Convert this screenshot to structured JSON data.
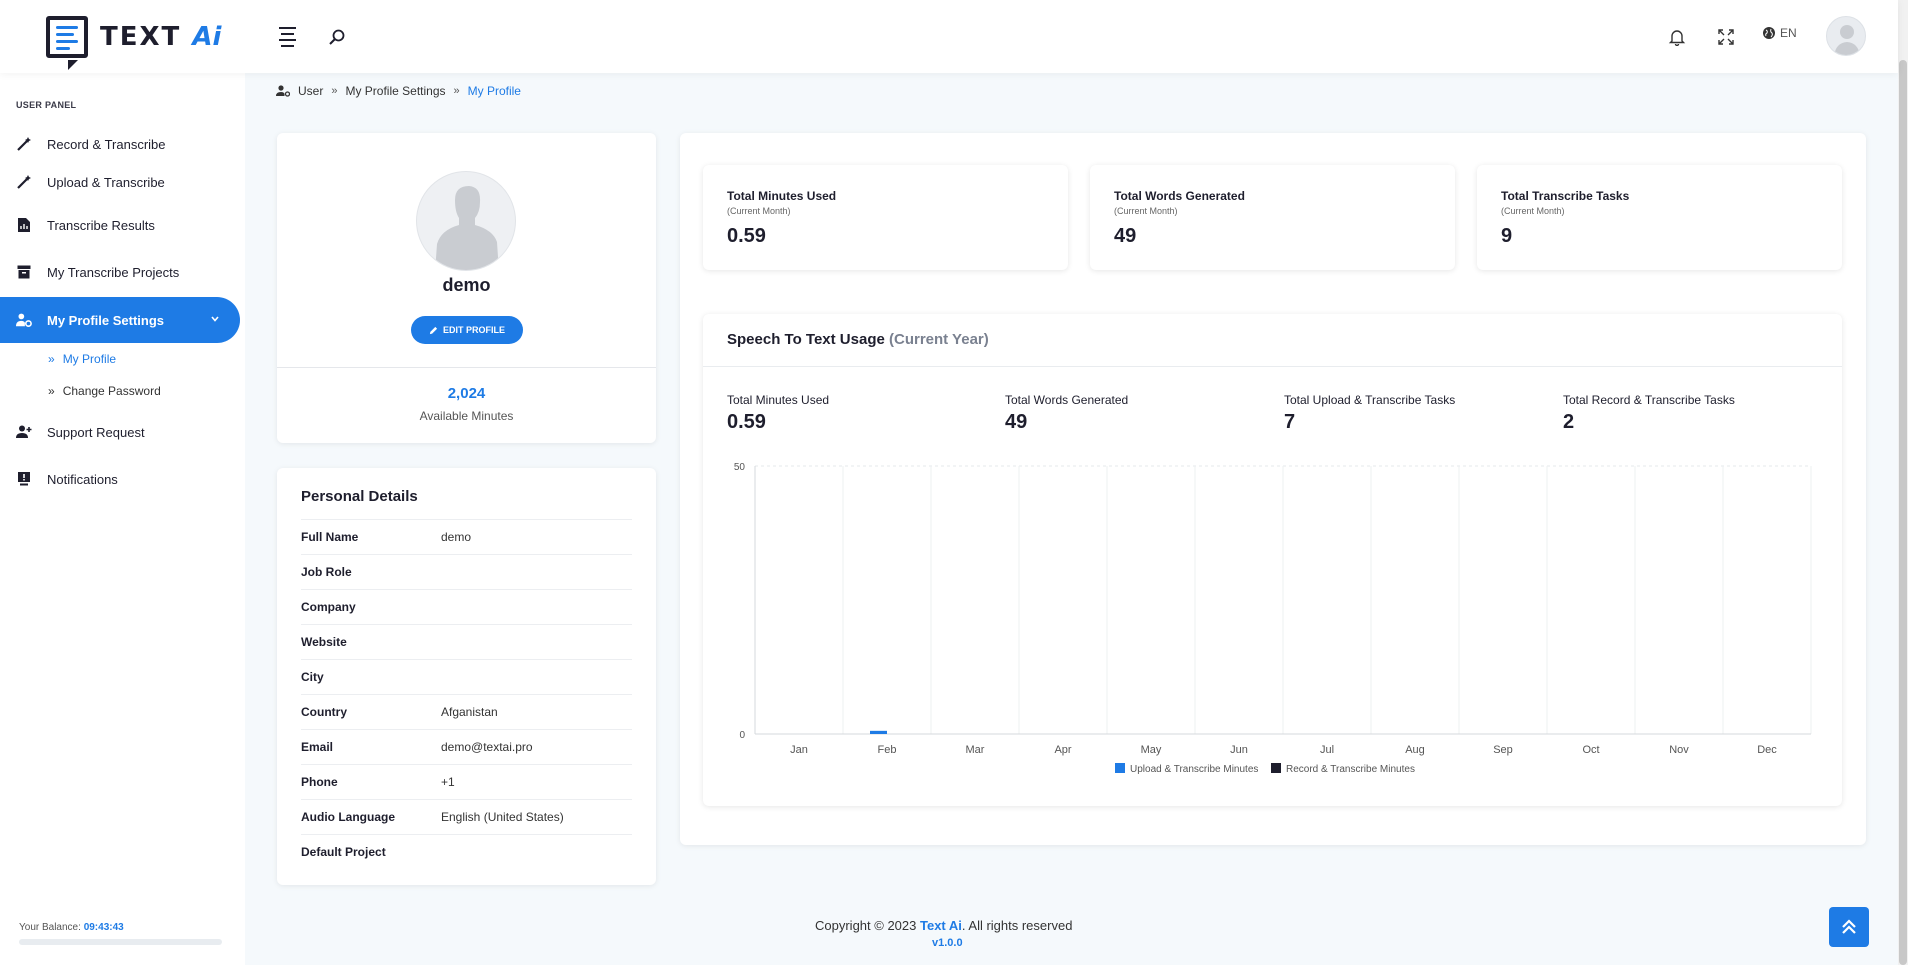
{
  "header": {
    "logo_text": "TEXT",
    "logo_accent": "Ai",
    "language": "EN"
  },
  "sidebar": {
    "panel_label": "USER PANEL",
    "items": [
      {
        "label": "Record & Transcribe",
        "icon": "magic-wand-icon"
      },
      {
        "label": "Upload & Transcribe",
        "icon": "magic-wand-icon"
      },
      {
        "label": "Transcribe Results",
        "icon": "file-audio-icon"
      },
      {
        "label": "My Transcribe Projects",
        "icon": "archive-box-icon"
      },
      {
        "label": "My Profile Settings",
        "icon": "user-gear-icon",
        "active": true
      },
      {
        "label": "Support Request",
        "icon": "user-plus-icon"
      },
      {
        "label": "Notifications",
        "icon": "monitor-alert-icon"
      }
    ],
    "subitems": [
      {
        "label": "My Profile",
        "active": true
      },
      {
        "label": "Change Password"
      }
    ],
    "balance_label": "Your Balance:",
    "balance_value": "09:43:43"
  },
  "breadcrumb": [
    "User",
    "My Profile Settings",
    "My Profile"
  ],
  "profile": {
    "name": "demo",
    "edit_label": "EDIT PROFILE",
    "available_minutes": "2,024",
    "available_label": "Available Minutes"
  },
  "details": {
    "title": "Personal Details",
    "rows": [
      {
        "k": "Full Name",
        "v": "demo"
      },
      {
        "k": "Job Role",
        "v": ""
      },
      {
        "k": "Company",
        "v": ""
      },
      {
        "k": "Website",
        "v": ""
      },
      {
        "k": "City",
        "v": ""
      },
      {
        "k": "Country",
        "v": "Afganistan"
      },
      {
        "k": "Email",
        "v": "demo@textai.pro"
      },
      {
        "k": "Phone",
        "v": "+1"
      },
      {
        "k": "Audio Language",
        "v": "English (United States)"
      },
      {
        "k": "Default Project",
        "v": ""
      }
    ]
  },
  "stats": [
    {
      "title": "Total Minutes Used",
      "sub": "(Current Month)",
      "value": "0.59"
    },
    {
      "title": "Total Words Generated",
      "sub": "(Current Month)",
      "value": "49"
    },
    {
      "title": "Total Transcribe Tasks",
      "sub": "(Current Month)",
      "value": "9"
    }
  ],
  "usage": {
    "title": "Speech To Text Usage",
    "title_muted": "(Current Year)",
    "metrics": [
      {
        "label": "Total Minutes Used",
        "value": "0.59"
      },
      {
        "label": "Total Words Generated",
        "value": "49"
      },
      {
        "label": "Total Upload & Transcribe Tasks",
        "value": "7"
      },
      {
        "label": "Total Record & Transcribe Tasks",
        "value": "2"
      }
    ]
  },
  "chart_data": {
    "type": "bar",
    "categories": [
      "Jan",
      "Feb",
      "Mar",
      "Apr",
      "May",
      "Jun",
      "Jul",
      "Aug",
      "Sep",
      "Oct",
      "Nov",
      "Dec"
    ],
    "series": [
      {
        "name": "Upload & Transcribe Minutes",
        "color": "#1e7be5",
        "values": [
          0,
          0.59,
          0,
          0,
          0,
          0,
          0,
          0,
          0,
          0,
          0,
          0
        ]
      },
      {
        "name": "Record & Transcribe Minutes",
        "color": "#1e1e2d",
        "values": [
          0,
          0,
          0,
          0,
          0,
          0,
          0,
          0,
          0,
          0,
          0,
          0
        ]
      }
    ],
    "ylim": [
      0,
      50
    ],
    "yticks": [
      0,
      50
    ],
    "grid": true,
    "legend": "bottom"
  },
  "footer": {
    "copyright_prefix": "Copyright © 2023",
    "brand": "Text Ai",
    "copyright_suffix": ". All rights reserved",
    "version": "v1.0.0"
  }
}
